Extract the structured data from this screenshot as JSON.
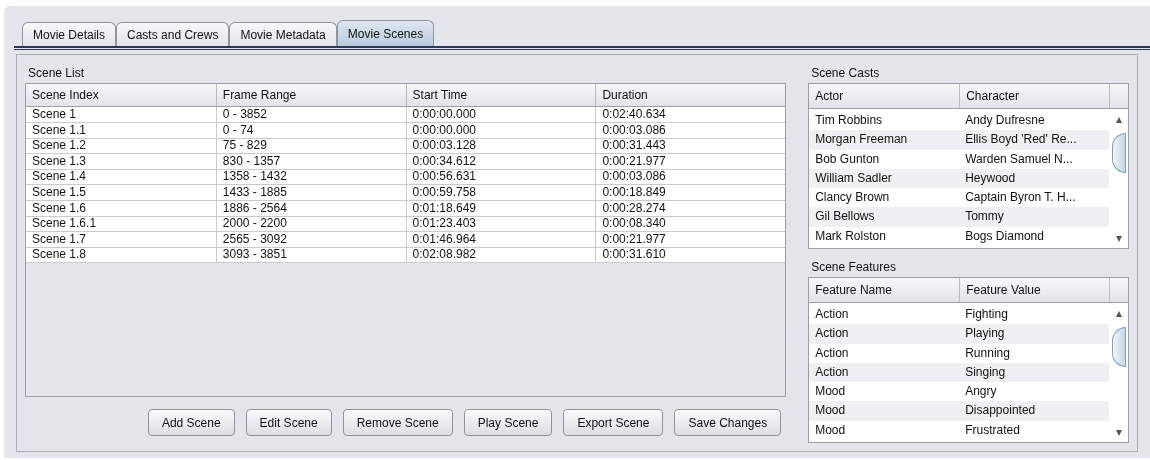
{
  "tabs": [
    {
      "label": "Movie Details",
      "selected": false
    },
    {
      "label": "Casts and Crews",
      "selected": false
    },
    {
      "label": "Movie Metadata",
      "selected": false
    },
    {
      "label": "Movie Scenes",
      "selected": true
    }
  ],
  "scene_list": {
    "title": "Scene List",
    "columns": [
      "Scene Index",
      "Frame Range",
      "Start Time",
      "Duration"
    ],
    "rows": [
      [
        "Scene 1",
        "0 - 3852",
        "0:00:00.000",
        "0:02:40.634"
      ],
      [
        "Scene 1.1",
        "0 - 74",
        "0:00:00.000",
        "0:00:03.086"
      ],
      [
        "Scene 1.2",
        "75 - 829",
        "0:00:03.128",
        "0:00:31.443"
      ],
      [
        "Scene 1.3",
        "830 - 1357",
        "0:00:34.612",
        "0:00:21.977"
      ],
      [
        "Scene 1.4",
        "1358 - 1432",
        "0:00:56.631",
        "0:00:03.086"
      ],
      [
        "Scene 1.5",
        "1433 - 1885",
        "0:00:59.758",
        "0:00:18.849"
      ],
      [
        "Scene 1.6",
        "1886 - 2564",
        "0:01:18.649",
        "0:00:28.274"
      ],
      [
        "Scene 1.6.1",
        "2000 - 2200",
        "0:01:23.403",
        "0:00:08.340"
      ],
      [
        "Scene 1.7",
        "2565 - 3092",
        "0:01:46.964",
        "0:00:21.977"
      ],
      [
        "Scene 1.8",
        "3093 - 3851",
        "0:02:08.982",
        "0:00:31.610"
      ]
    ]
  },
  "buttons": [
    "Add Scene",
    "Edit Scene",
    "Remove Scene",
    "Play Scene",
    "Export Scene",
    "Save Changes"
  ],
  "scene_casts": {
    "title": "Scene Casts",
    "columns": [
      "Actor",
      "Character"
    ],
    "rows": [
      [
        "Tim Robbins",
        "Andy Dufresne"
      ],
      [
        "Morgan Freeman",
        "Ellis Boyd 'Red' Re..."
      ],
      [
        "Bob Gunton",
        "Warden Samuel N..."
      ],
      [
        "William Sadler",
        "Heywood"
      ],
      [
        "Clancy Brown",
        "Captain Byron T. H..."
      ],
      [
        "Gil Bellows",
        "Tommy"
      ],
      [
        "Mark Rolston",
        "Bogs Diamond"
      ]
    ]
  },
  "scene_features": {
    "title": "Scene Features",
    "columns": [
      "Feature Name",
      "Feature Value"
    ],
    "rows": [
      [
        "Action",
        "Fighting"
      ],
      [
        "Action",
        "Playing"
      ],
      [
        "Action",
        "Running"
      ],
      [
        "Action",
        "Singing"
      ],
      [
        "Mood",
        "Angry"
      ],
      [
        "Mood",
        "Disappointed"
      ],
      [
        "Mood",
        "Frustrated"
      ]
    ]
  }
}
